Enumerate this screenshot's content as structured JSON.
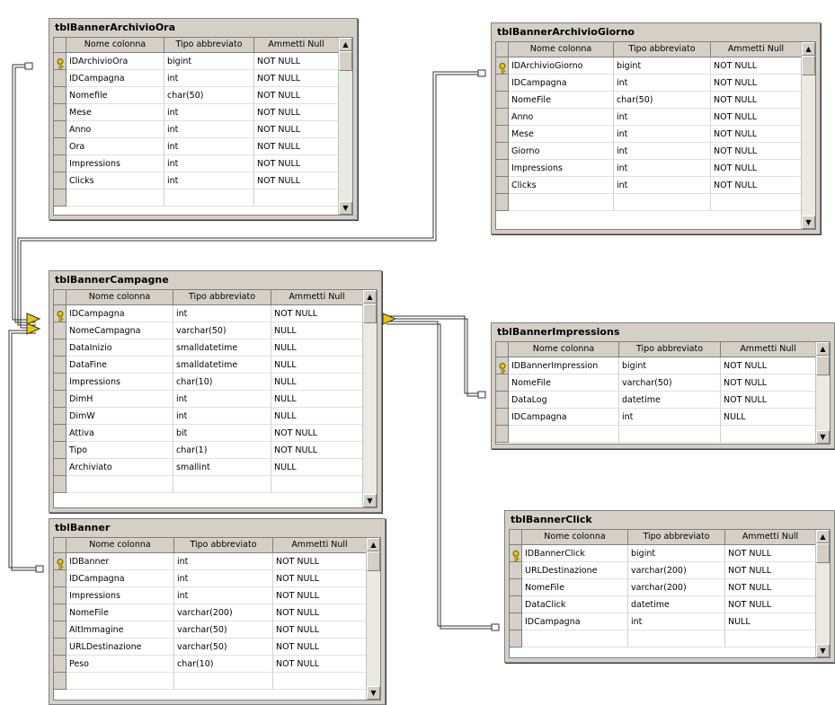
{
  "headers": {
    "col_name": "Nome colonna",
    "col_type": "Tipo abbreviato",
    "col_null": "Ammetti Null"
  },
  "tables": [
    {
      "id": "ora",
      "name": "tblBannerArchivioOra",
      "rows": [
        {
          "name": "IDArchivioOra",
          "type": "bigint",
          "null": "NOT NULL",
          "pk": true
        },
        {
          "name": "IDCampagna",
          "type": "int",
          "null": "NOT NULL"
        },
        {
          "name": "Nomefile",
          "type": "char(50)",
          "null": "NOT NULL"
        },
        {
          "name": "Mese",
          "type": "int",
          "null": "NOT NULL"
        },
        {
          "name": "Anno",
          "type": "int",
          "null": "NOT NULL"
        },
        {
          "name": "Ora",
          "type": "int",
          "null": "NOT NULL"
        },
        {
          "name": "Impressions",
          "type": "int",
          "null": "NOT NULL"
        },
        {
          "name": "Clicks",
          "type": "int",
          "null": "NOT NULL"
        }
      ]
    },
    {
      "id": "giorno",
      "name": "tblBannerArchivioGiorno",
      "rows": [
        {
          "name": "IDArchivioGiorno",
          "type": "bigint",
          "null": "NOT NULL",
          "pk": true
        },
        {
          "name": "IDCampagna",
          "type": "int",
          "null": "NOT NULL"
        },
        {
          "name": "NomeFile",
          "type": "char(50)",
          "null": "NOT NULL"
        },
        {
          "name": "Anno",
          "type": "int",
          "null": "NOT NULL"
        },
        {
          "name": "Mese",
          "type": "int",
          "null": "NOT NULL"
        },
        {
          "name": "Giorno",
          "type": "int",
          "null": "NOT NULL"
        },
        {
          "name": "Impressions",
          "type": "int",
          "null": "NOT NULL"
        },
        {
          "name": "Clicks",
          "type": "int",
          "null": "NOT NULL"
        }
      ]
    },
    {
      "id": "campagne",
      "name": "tblBannerCampagne",
      "rows": [
        {
          "name": "IDCampagna",
          "type": "int",
          "null": "NOT NULL",
          "pk": true
        },
        {
          "name": "NomeCampagna",
          "type": "varchar(50)",
          "null": "NULL"
        },
        {
          "name": "DataInizio",
          "type": "smalldatetime",
          "null": "NULL"
        },
        {
          "name": "DataFine",
          "type": "smalldatetime",
          "null": "NULL"
        },
        {
          "name": "Impressions",
          "type": "char(10)",
          "null": "NULL"
        },
        {
          "name": "DimH",
          "type": "int",
          "null": "NULL"
        },
        {
          "name": "DimW",
          "type": "int",
          "null": "NULL"
        },
        {
          "name": "Attiva",
          "type": "bit",
          "null": "NOT NULL"
        },
        {
          "name": "Tipo",
          "type": "char(1)",
          "null": "NOT NULL"
        },
        {
          "name": "Archiviato",
          "type": "smallint",
          "null": "NULL"
        }
      ]
    },
    {
      "id": "impressions",
      "name": "tblBannerImpressions",
      "rows": [
        {
          "name": "IDBannerImpression",
          "type": "bigint",
          "null": "NOT NULL",
          "pk": true
        },
        {
          "name": "NomeFile",
          "type": "varchar(50)",
          "null": "NOT NULL"
        },
        {
          "name": "DataLog",
          "type": "datetime",
          "null": "NOT NULL"
        },
        {
          "name": "IDCampagna",
          "type": "int",
          "null": "NULL"
        }
      ]
    },
    {
      "id": "banner",
      "name": "tblBanner",
      "rows": [
        {
          "name": "IDBanner",
          "type": "int",
          "null": "NOT NULL",
          "pk": true
        },
        {
          "name": "IDCampagna",
          "type": "int",
          "null": "NOT NULL"
        },
        {
          "name": "Impressions",
          "type": "int",
          "null": "NOT NULL"
        },
        {
          "name": "NomeFile",
          "type": "varchar(200)",
          "null": "NOT NULL"
        },
        {
          "name": "AltImmagine",
          "type": "varchar(50)",
          "null": "NOT NULL"
        },
        {
          "name": "URLDestinazione",
          "type": "varchar(50)",
          "null": "NOT NULL"
        },
        {
          "name": "Peso",
          "type": "char(10)",
          "null": "NOT NULL"
        }
      ]
    },
    {
      "id": "click",
      "name": "tblBannerClick",
      "rows": [
        {
          "name": "IDBannerClick",
          "type": "bigint",
          "null": "NOT NULL",
          "pk": true
        },
        {
          "name": "URLDestinazione",
          "type": "varchar(200)",
          "null": "NOT NULL"
        },
        {
          "name": "NomeFile",
          "type": "varchar(200)",
          "null": "NOT NULL"
        },
        {
          "name": "DataClick",
          "type": "datetime",
          "null": "NOT NULL"
        },
        {
          "name": "IDCampagna",
          "type": "int",
          "null": "NULL"
        }
      ]
    }
  ],
  "colors": {
    "window": "#d4d0c8",
    "border": "#808080",
    "line": "#000000",
    "key": "#e8c800"
  }
}
